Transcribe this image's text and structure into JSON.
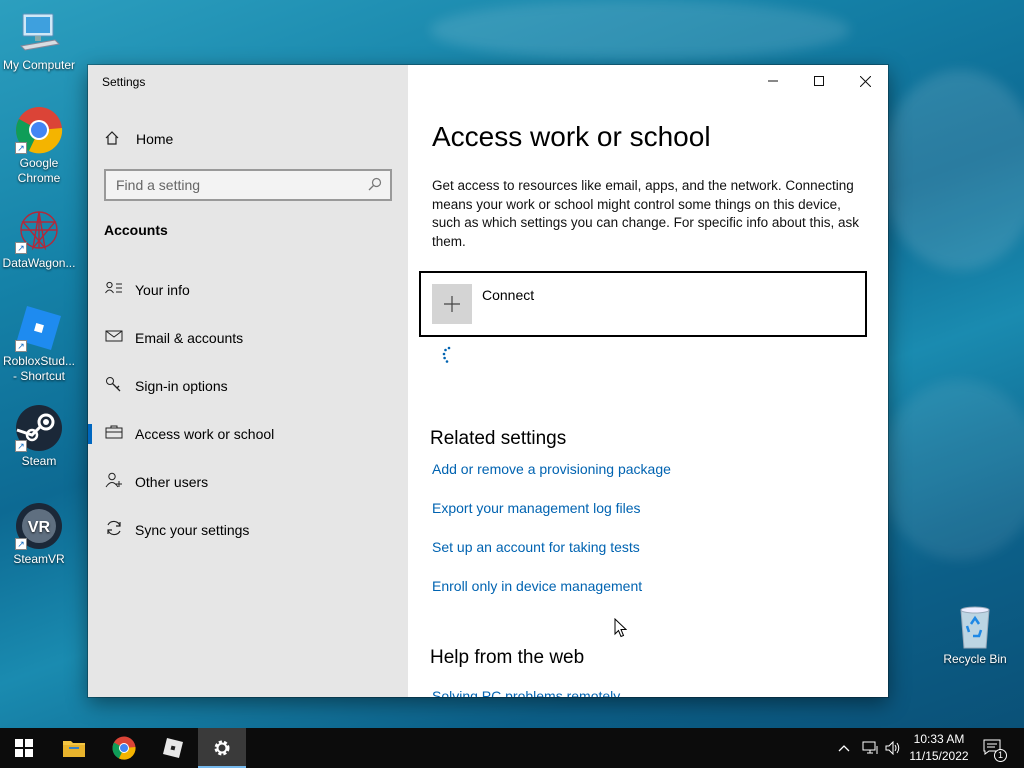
{
  "desktop": {
    "icons": [
      {
        "label_line1": "My Computer",
        "label_line2": ""
      },
      {
        "label_line1": "Google",
        "label_line2": "Chrome"
      },
      {
        "label_line1": "DataWagon...",
        "label_line2": ""
      },
      {
        "label_line1": "RobloxStud...",
        "label_line2": "- Shortcut"
      },
      {
        "label_line1": "Steam",
        "label_line2": ""
      },
      {
        "label_line1": "SteamVR",
        "label_line2": ""
      },
      {
        "label_line1": "Recycle Bin",
        "label_line2": ""
      }
    ],
    "steamvr_badge": "VR"
  },
  "window": {
    "title": "Settings",
    "caption": {
      "minimize": "—",
      "maximize": "☐",
      "close": "✕"
    }
  },
  "nav": {
    "home_label": "Home",
    "search_placeholder": "Find a setting",
    "section_heading": "Accounts",
    "items": [
      {
        "label": "Your info",
        "icon": "your-info-icon",
        "active": false
      },
      {
        "label": "Email & accounts",
        "icon": "mail-icon",
        "active": false
      },
      {
        "label": "Sign-in options",
        "icon": "key-icon",
        "active": false
      },
      {
        "label": "Access work or school",
        "icon": "briefcase-icon",
        "active": true
      },
      {
        "label": "Other users",
        "icon": "person-icon",
        "active": false
      },
      {
        "label": "Sync your settings",
        "icon": "sync-icon",
        "active": false
      }
    ]
  },
  "content": {
    "title": "Access work or school",
    "description": "Get access to resources like email, apps, and the network. Connecting means your work or school might control some things on this device, such as which settings you can change. For specific info about this, ask them.",
    "connect_label": "Connect",
    "related_heading": "Related settings",
    "related_links": [
      "Add or remove a provisioning package",
      "Export your management log files",
      "Set up an account for taking tests",
      "Enroll only in device management"
    ],
    "help_heading": "Help from the web",
    "help_links": [
      "Solving PC problems remotely"
    ]
  },
  "taskbar": {
    "time": "10:33 AM",
    "date": "11/15/2022",
    "notification_count": "1",
    "accent": "#76b9ed"
  }
}
